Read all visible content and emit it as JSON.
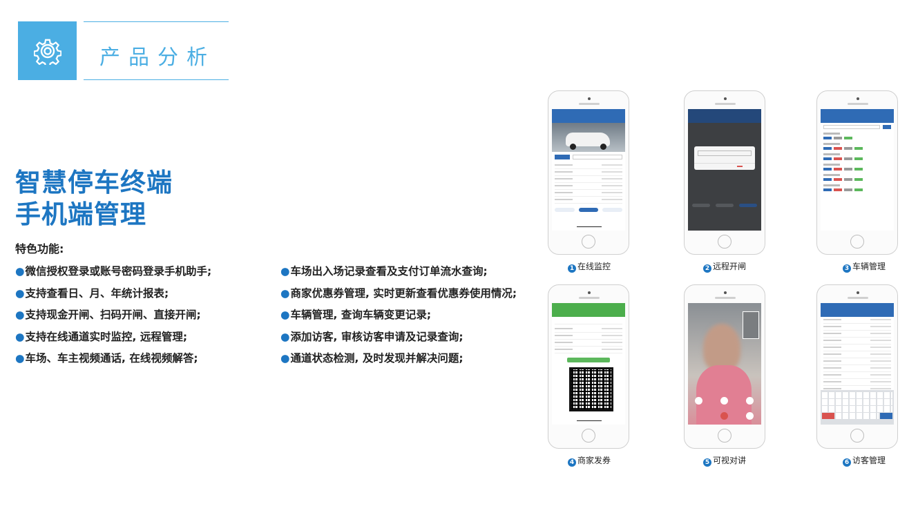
{
  "header": {
    "title": "产品分析",
    "icon": "gear-icon",
    "accent_color": "#4baee3"
  },
  "headline": {
    "line1": "智慧停车终端",
    "line2": "手机端管理",
    "color": "#1d76c2"
  },
  "features": {
    "label": "特色功能:",
    "bullet": "●",
    "left": [
      "微信授权登录或账号密码登录手机助手;",
      "支持查看日、月、年统计报表;",
      "支持现金开闸、扫码开闸、直接开闸;",
      "支持在线通道实时监控, 远程管理;",
      "车场、车主视频通话, 在线视频解答;"
    ],
    "right": [
      "车场出入场记录查看及支付订单流水查询;",
      "商家优惠券管理, 实时更新查看优惠券使用情况;",
      "车辆管理, 查询车辆变更记录;",
      "添加访客, 审核访客申请及记录查询;",
      "通道状态检测, 及时发现并解决问题;"
    ]
  },
  "phones": [
    {
      "num": "1",
      "label": "在线监控"
    },
    {
      "num": "2",
      "label": "远程开闸"
    },
    {
      "num": "3",
      "label": "车辆管理"
    },
    {
      "num": "4",
      "label": "商家发券"
    },
    {
      "num": "5",
      "label": "可视对讲"
    },
    {
      "num": "6",
      "label": "访客管理"
    }
  ]
}
